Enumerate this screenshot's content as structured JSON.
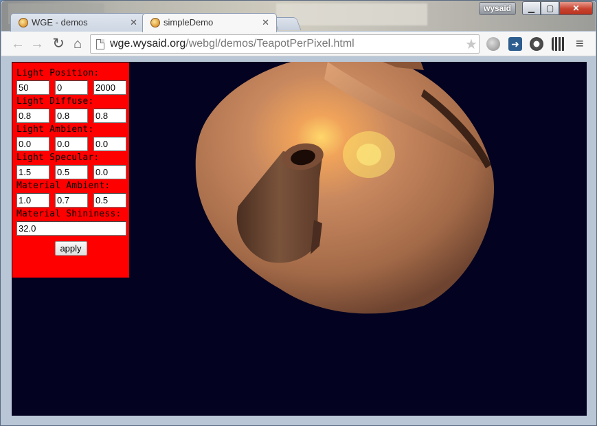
{
  "window": {
    "profile_name": "wysaid",
    "min_glyph": "▁",
    "max_glyph": "▢",
    "close_glyph": "✕"
  },
  "tabs": [
    {
      "title": "WGE - demos",
      "close": "✕",
      "active": false
    },
    {
      "title": "simpleDemo",
      "close": "✕",
      "active": true
    }
  ],
  "toolbar": {
    "back_glyph": "←",
    "forward_glyph": "→",
    "reload_glyph": "↻",
    "home_glyph": "⌂",
    "url_host": "wge.wysaid.org",
    "url_path": "/webgl/demos/TeapotPerPixel.html",
    "star_glyph": "★",
    "menu_glyph": "≡",
    "extensions": [
      "globe-icon",
      "share-icon",
      "evernote-icon",
      "qr-code-icon"
    ]
  },
  "panel": {
    "groups": [
      {
        "label": "Light Position:",
        "values": [
          "50",
          "0",
          "2000"
        ]
      },
      {
        "label": "Light Diffuse:",
        "values": [
          "0.8",
          "0.8",
          "0.8"
        ]
      },
      {
        "label": "Light Ambient:",
        "values": [
          "0.0",
          "0.0",
          "0.0"
        ]
      },
      {
        "label": "Light Specular:",
        "values": [
          "1.5",
          "0.5",
          "0.0"
        ]
      },
      {
        "label": "Material Ambient:",
        "values": [
          "1.0",
          "0.7",
          "0.5"
        ]
      },
      {
        "label": "Material Shininess:",
        "values": [
          "32.0"
        ]
      }
    ],
    "apply_label": "apply"
  },
  "colors": {
    "panel_bg": "#ff0000",
    "canvas_bg": "#030321",
    "teapot_base": "#c48a60"
  }
}
